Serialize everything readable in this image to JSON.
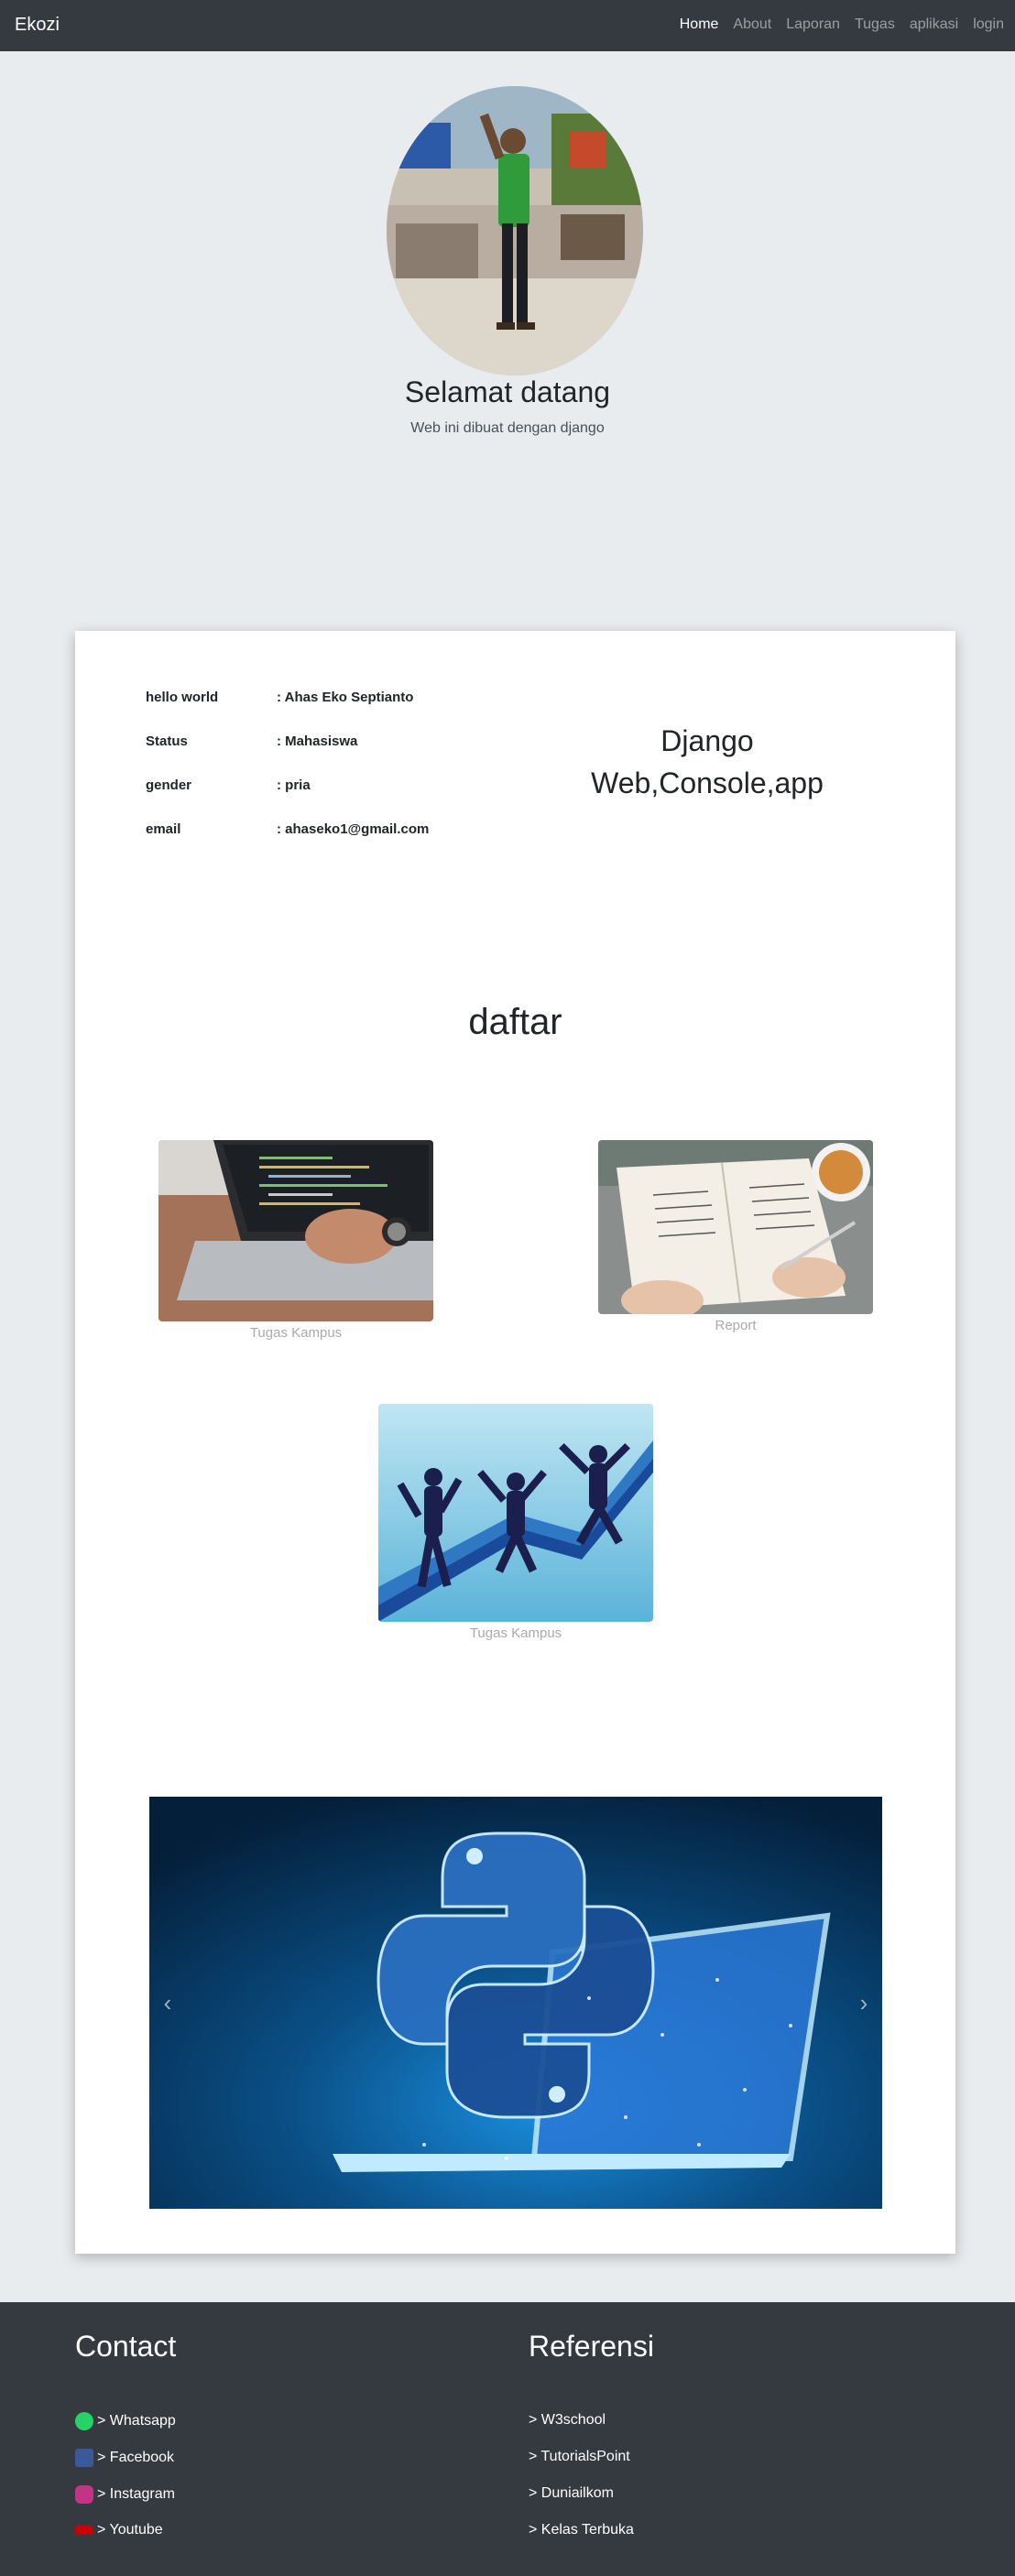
{
  "nav": {
    "brand": "Ekozi",
    "items": [
      {
        "label": "Home",
        "active": true
      },
      {
        "label": "About",
        "active": false
      },
      {
        "label": "Laporan",
        "active": false
      },
      {
        "label": "Tugas",
        "active": false
      },
      {
        "label": "aplikasi",
        "active": false
      },
      {
        "label": "login",
        "active": false
      }
    ]
  },
  "hero": {
    "title": "Selamat datang",
    "subtitle": "Web ini dibuat dengan django"
  },
  "profile": {
    "rows": [
      {
        "key": "hello world",
        "value": ": Ahas Eko Septianto"
      },
      {
        "key": "Status",
        "value": ": Mahasiswa"
      },
      {
        "key": "gender",
        "value": ": pria"
      },
      {
        "key": "email",
        "value": ": ahaseko1@gmail.com"
      }
    ],
    "tagline_line1": "Django",
    "tagline_line2": "Web,Console,app"
  },
  "daftar": {
    "title": "daftar",
    "items": [
      {
        "caption": "Tugas Kampus"
      },
      {
        "caption": "Report"
      },
      {
        "caption": "Tugas Kampus"
      }
    ]
  },
  "carousel": {
    "prev_icon": "chevron-left-icon",
    "next_icon": "chevron-right-icon"
  },
  "footer": {
    "contact_title": "Contact",
    "contact_links": [
      {
        "label": "> Whatsapp",
        "icon": "whatsapp-icon"
      },
      {
        "label": "> Facebook",
        "icon": "facebook-icon"
      },
      {
        "label": "> Instagram",
        "icon": "instagram-icon"
      },
      {
        "label": "> Youtube",
        "icon": "youtube-icon"
      }
    ],
    "referensi_title": "Referensi",
    "referensi_links": [
      {
        "label": "> W3school"
      },
      {
        "label": "> TutorialsPoint"
      },
      {
        "label": "> Duniailkom"
      },
      {
        "label": "> Kelas Terbuka"
      }
    ]
  },
  "colors": {
    "navbar": "#343a40",
    "hero_bg": "#e9ecef",
    "card_bg": "#ffffff",
    "caption": "#aaaaaa"
  }
}
